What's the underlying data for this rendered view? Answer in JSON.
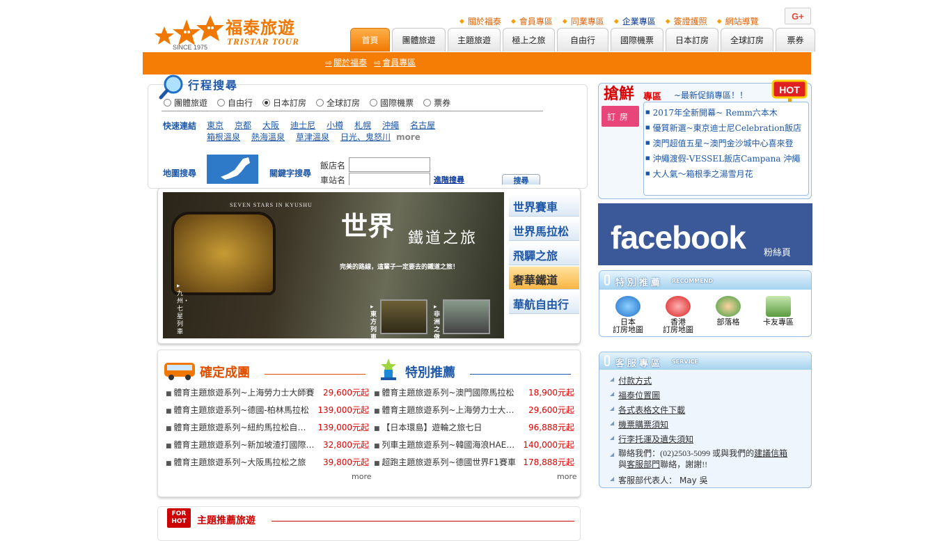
{
  "header": {
    "logo_cn": "福泰旅遊",
    "logo_en": "TRISTAR TOUR",
    "logo_since": "SINCE 1975",
    "top_links": [
      "關於福泰",
      "會員專區",
      "同業專區",
      "企業專區",
      "簽證護照",
      "網站導覽"
    ],
    "gplus": "G+",
    "tabs": [
      "首頁",
      "團體旅遊",
      "主題旅遊",
      "極上之旅",
      "自由行",
      "國際機票",
      "日本訂房",
      "全球訂房",
      "票券"
    ],
    "subnav": [
      "關於福泰",
      "會員專區"
    ]
  },
  "search": {
    "title": "行程搜尋",
    "radios": [
      "團體旅遊",
      "自由行",
      "日本訂房",
      "全球訂房",
      "國際機票",
      "票券"
    ],
    "selected": "日本訂房",
    "quick_label": "快速連結",
    "quick_links": [
      "東京",
      "京都",
      "大阪",
      "迪士尼",
      "小樽",
      "札幌",
      "沖繩",
      "名古屋",
      "箱根溫泉",
      "熱海溫泉",
      "草津溫泉",
      "日光、鬼怒川"
    ],
    "quick_more": "more",
    "map_label": "地圖搜尋",
    "keyword_label": "關鍵字搜尋",
    "hotel_label": "飯店名",
    "station_label": "車站名",
    "hotel_value": "",
    "station_value": "",
    "advanced": "進階搜尋",
    "search_btn": "搜尋"
  },
  "banner": {
    "en_title": "SEVEN STARS IN KYUSHU",
    "big": "世界",
    "sub": "鐵道之旅",
    "line": "完美的路線，這輩子一定要去的鐵道之旅！",
    "v1": "▸九州・七星列車",
    "v2": "▸東方列車",
    "v3": "▸非洲之傲",
    "side_tabs": [
      "世界賽車",
      "世界馬拉松",
      "飛驒之旅",
      "奢華鐵道",
      "華航自由行"
    ],
    "active_tab": "奢華鐵道"
  },
  "lists": {
    "left_title": "確定成團",
    "right_title": "特別推薦",
    "left": [
      {
        "name": "體育主題旅遊系列~上海勞力士大師賽",
        "price": "29,600元起"
      },
      {
        "name": "體育主題旅遊系列~德國-柏林馬拉松",
        "price": "139,000元起"
      },
      {
        "name": "體育主題旅遊系列~紐約馬拉松自由行",
        "price": "139,000元起"
      },
      {
        "name": "體育主題旅遊系列~新加坡渣打國際馬拉松",
        "price": "32,800元起"
      },
      {
        "name": "體育主題旅遊系列~大阪馬拉松之旅",
        "price": "39,800元起"
      }
    ],
    "right": [
      {
        "name": "體育主題旅遊系列~澳門國際馬拉松",
        "price": "18,900元起"
      },
      {
        "name": "體育主題旅遊系列~上海勞力士大師賽",
        "price": "29,600元起"
      },
      {
        "name": "【日本環島】遊輪之旅七日",
        "price": "96,888元起"
      },
      {
        "name": "列車主題旅遊系列~韓國海浪HAERANG",
        "price": "140,000元起"
      },
      {
        "name": "超跑主題旅遊系列~德國世界F1賽車",
        "price": "178,888元起"
      }
    ],
    "more": "more"
  },
  "theme": {
    "badge": "FOR HOT",
    "title": "主題推薦旅遊"
  },
  "promo": {
    "t1": "搶鮮",
    "t2": "專區",
    "sub": "~最新促銷專區！！",
    "hot": "HOT",
    "tab": "訂房",
    "items": [
      "2017年全新開幕~ Remm六本木",
      "優質新選~東京迪士尼Celebration飯店",
      "澳門超值五星~澳門金沙城中心喜來登",
      "沖繩渡假-VESSEL飯店Campana 沖繩",
      "大人氣～箱根季之湯雪月花"
    ]
  },
  "facebook": {
    "word": "facebook",
    "sub": "粉絲頁"
  },
  "recommend": {
    "title": "特別推薦",
    "en": "RECOMMEND",
    "items": [
      {
        "l1": "日本",
        "l2": "訂房地圖"
      },
      {
        "l1": "香港",
        "l2": "訂房地圖"
      },
      {
        "l1": "",
        "l2": "部落格"
      },
      {
        "l1": "",
        "l2": "卡友專區"
      }
    ]
  },
  "service": {
    "title": "客服專區",
    "en": "SERVICE",
    "links": [
      "付款方式",
      "福泰位置圖",
      "各式表格文件下載",
      "機票購票須知",
      "行李托運及遺失須知"
    ],
    "contact_pre": "聯絡我們：(02)2503-5099 或與我們的",
    "contact_link1": "建議信箱",
    "contact_mid": "與",
    "contact_link2": "客服部門",
    "contact_post": "聯絡，謝謝!!",
    "rep": "客服部代表人： May 吳"
  }
}
